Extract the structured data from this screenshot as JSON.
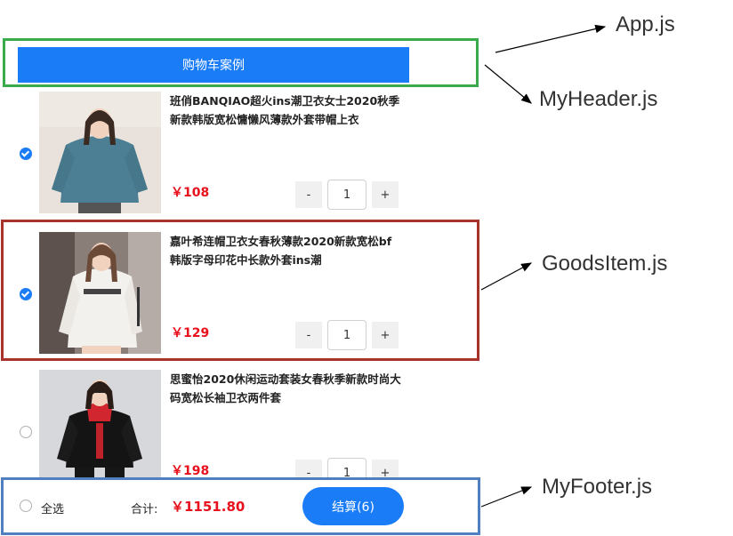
{
  "header": {
    "title": "购物车案例"
  },
  "goods": [
    {
      "title": "班俏BANQIAO超火ins潮卫衣女士2020秋季新款韩版宽松慵懒风薄款外套带帽上衣",
      "price": "￥108",
      "count": "1",
      "checked": true
    },
    {
      "title": "嘉叶希连帽卫衣女春秋薄款2020新款宽松bf韩版字母印花中长款外套ins潮",
      "price": "￥129",
      "count": "1",
      "checked": true
    },
    {
      "title": "思蜜怡2020休闲运动套装女春秋季新款时尚大码宽松长袖卫衣两件套",
      "price": "￥198",
      "count": "1",
      "checked": false
    }
  ],
  "stepper": {
    "minus": "-",
    "plus": "+"
  },
  "footer": {
    "select_all": "全选",
    "total_label": "合计:",
    "total_value": "￥1151.80",
    "checkout_label": "结算(6)"
  },
  "annotations": {
    "app": "App.js",
    "header": "MyHeader.js",
    "goods_item": "GoodsItem.js",
    "footer": "MyFooter.js"
  },
  "colors": {
    "primary": "#1a7cf7",
    "price": "#e8101c",
    "header_outline": "#3aaa4a",
    "item_outline": "#a8322c",
    "footer_outline": "#4f7fc0"
  }
}
